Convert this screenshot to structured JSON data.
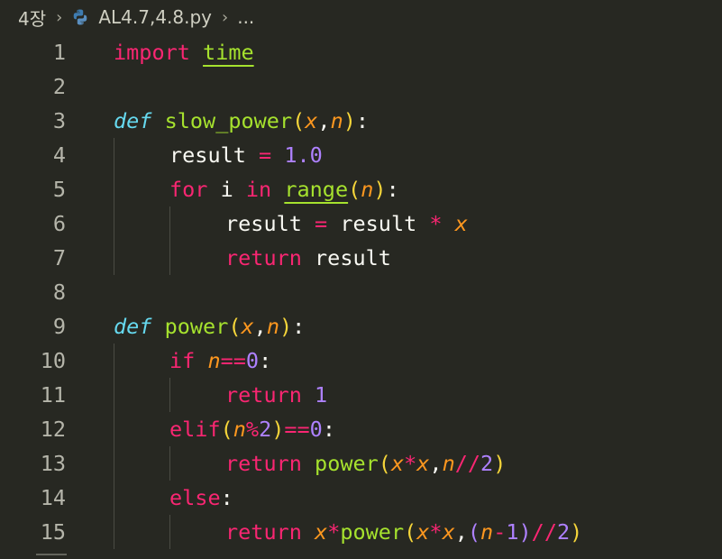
{
  "breadcrumb": {
    "folder": "4장",
    "separator": "›",
    "file": "AL4.7,4.8.py",
    "more": "..."
  },
  "colors": {
    "background": "#272822",
    "keyword": "#f92672",
    "def_keyword": "#66d9ef",
    "function": "#a6e22e",
    "parameter": "#fd971f",
    "number": "#ae81ff",
    "text": "#f8f8f2",
    "bracket": "#f5d53a"
  },
  "lines": [
    {
      "num": "1",
      "indent": 0,
      "tokens": [
        {
          "t": "import",
          "c": "k"
        },
        {
          "t": " ",
          "c": "w"
        },
        {
          "t": "time",
          "c": "f u"
        }
      ]
    },
    {
      "num": "2",
      "indent": 0,
      "tokens": []
    },
    {
      "num": "3",
      "indent": 0,
      "tokens": [
        {
          "t": "def",
          "c": "d"
        },
        {
          "t": " ",
          "c": "w"
        },
        {
          "t": "slow_power",
          "c": "f"
        },
        {
          "t": "(",
          "c": "br"
        },
        {
          "t": "x",
          "c": "p"
        },
        {
          "t": ",",
          "c": "w"
        },
        {
          "t": "n",
          "c": "p"
        },
        {
          "t": ")",
          "c": "br"
        },
        {
          "t": ":",
          "c": "w"
        }
      ]
    },
    {
      "num": "4",
      "indent": 1,
      "tokens": [
        {
          "t": "result",
          "c": "w"
        },
        {
          "t": " ",
          "c": "w"
        },
        {
          "t": "=",
          "c": "o"
        },
        {
          "t": " ",
          "c": "w"
        },
        {
          "t": "1.0",
          "c": "n"
        }
      ]
    },
    {
      "num": "5",
      "indent": 1,
      "tokens": [
        {
          "t": "for",
          "c": "k"
        },
        {
          "t": " i ",
          "c": "w"
        },
        {
          "t": "in",
          "c": "k"
        },
        {
          "t": " ",
          "c": "w"
        },
        {
          "t": "range",
          "c": "f u"
        },
        {
          "t": "(",
          "c": "br"
        },
        {
          "t": "n",
          "c": "p"
        },
        {
          "t": ")",
          "c": "br"
        },
        {
          "t": ":",
          "c": "w"
        }
      ]
    },
    {
      "num": "6",
      "indent": 2,
      "tokens": [
        {
          "t": "result",
          "c": "w"
        },
        {
          "t": " ",
          "c": "w"
        },
        {
          "t": "=",
          "c": "o"
        },
        {
          "t": " result ",
          "c": "w"
        },
        {
          "t": "*",
          "c": "o"
        },
        {
          "t": " ",
          "c": "w"
        },
        {
          "t": "x",
          "c": "p"
        }
      ]
    },
    {
      "num": "7",
      "indent": 2,
      "tokens": [
        {
          "t": "return",
          "c": "k"
        },
        {
          "t": " result",
          "c": "w"
        }
      ]
    },
    {
      "num": "8",
      "indent": 0,
      "tokens": []
    },
    {
      "num": "9",
      "indent": 0,
      "tokens": [
        {
          "t": "def",
          "c": "d"
        },
        {
          "t": " ",
          "c": "w"
        },
        {
          "t": "power",
          "c": "f"
        },
        {
          "t": "(",
          "c": "br"
        },
        {
          "t": "x",
          "c": "p"
        },
        {
          "t": ",",
          "c": "w"
        },
        {
          "t": "n",
          "c": "p"
        },
        {
          "t": ")",
          "c": "br"
        },
        {
          "t": ":",
          "c": "w"
        }
      ]
    },
    {
      "num": "10",
      "indent": 1,
      "tokens": [
        {
          "t": "if",
          "c": "k"
        },
        {
          "t": " ",
          "c": "w"
        },
        {
          "t": "n",
          "c": "p"
        },
        {
          "t": "==",
          "c": "o"
        },
        {
          "t": "0",
          "c": "n"
        },
        {
          "t": ":",
          "c": "w"
        }
      ]
    },
    {
      "num": "11",
      "indent": 2,
      "tokens": [
        {
          "t": "return",
          "c": "k"
        },
        {
          "t": " ",
          "c": "w"
        },
        {
          "t": "1",
          "c": "n"
        }
      ]
    },
    {
      "num": "12",
      "indent": 1,
      "tokens": [
        {
          "t": "elif",
          "c": "k"
        },
        {
          "t": "(",
          "c": "br"
        },
        {
          "t": "n",
          "c": "p"
        },
        {
          "t": "%",
          "c": "o"
        },
        {
          "t": "2",
          "c": "n"
        },
        {
          "t": ")",
          "c": "br"
        },
        {
          "t": "==",
          "c": "o"
        },
        {
          "t": "0",
          "c": "n"
        },
        {
          "t": ":",
          "c": "w"
        }
      ]
    },
    {
      "num": "13",
      "indent": 2,
      "tokens": [
        {
          "t": "return",
          "c": "k"
        },
        {
          "t": " ",
          "c": "w"
        },
        {
          "t": "power",
          "c": "f"
        },
        {
          "t": "(",
          "c": "br"
        },
        {
          "t": "x",
          "c": "p"
        },
        {
          "t": "*",
          "c": "o"
        },
        {
          "t": "x",
          "c": "p"
        },
        {
          "t": ",",
          "c": "w"
        },
        {
          "t": "n",
          "c": "p"
        },
        {
          "t": "//",
          "c": "o"
        },
        {
          "t": "2",
          "c": "n"
        },
        {
          "t": ")",
          "c": "br"
        }
      ]
    },
    {
      "num": "14",
      "indent": 1,
      "tokens": [
        {
          "t": "else",
          "c": "k"
        },
        {
          "t": ":",
          "c": "w"
        }
      ]
    },
    {
      "num": "15",
      "indent": 2,
      "tokens": [
        {
          "t": "return",
          "c": "k"
        },
        {
          "t": " ",
          "c": "w"
        },
        {
          "t": "x",
          "c": "p"
        },
        {
          "t": "*",
          "c": "o"
        },
        {
          "t": "power",
          "c": "f"
        },
        {
          "t": "(",
          "c": "br"
        },
        {
          "t": "x",
          "c": "p"
        },
        {
          "t": "*",
          "c": "o"
        },
        {
          "t": "x",
          "c": "p"
        },
        {
          "t": ",",
          "c": "w"
        },
        {
          "t": "(",
          "c": "n"
        },
        {
          "t": "n",
          "c": "p"
        },
        {
          "t": "-",
          "c": "o"
        },
        {
          "t": "1",
          "c": "n"
        },
        {
          "t": ")",
          "c": "n"
        },
        {
          "t": "//",
          "c": "o"
        },
        {
          "t": "2",
          "c": "n"
        },
        {
          "t": ")",
          "c": "br"
        }
      ]
    }
  ]
}
